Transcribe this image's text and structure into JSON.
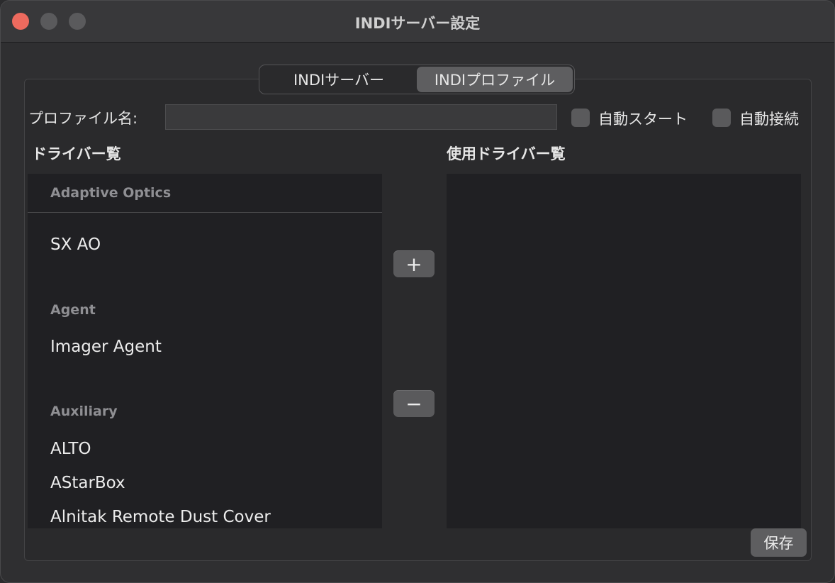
{
  "window": {
    "title": "INDIサーバー設定"
  },
  "tabs": [
    {
      "label": "INDIサーバー",
      "active": false
    },
    {
      "label": "INDIプロファイル",
      "active": true
    }
  ],
  "profile": {
    "name_label": "プロファイル名:",
    "name_value": "",
    "auto_start_label": "自動スタート",
    "auto_connect_label": "自動接続"
  },
  "driver_list": {
    "title": "ドライバー覧",
    "groups": [
      {
        "name": "Adaptive Optics",
        "items": [
          "SX AO"
        ]
      },
      {
        "name": "Agent",
        "items": [
          "Imager Agent"
        ]
      },
      {
        "name": "Auxiliary",
        "items": [
          "ALTO",
          "AStarBox",
          "Alnitak Remote Dust Cover"
        ]
      }
    ]
  },
  "used_list": {
    "title": "使用ドライバー覧"
  },
  "buttons": {
    "add": "+",
    "remove": "−",
    "save": "保存"
  },
  "colors": {
    "close": "#ed6a5e",
    "list_bg": "#202023",
    "window_bg": "#2f2f31"
  }
}
